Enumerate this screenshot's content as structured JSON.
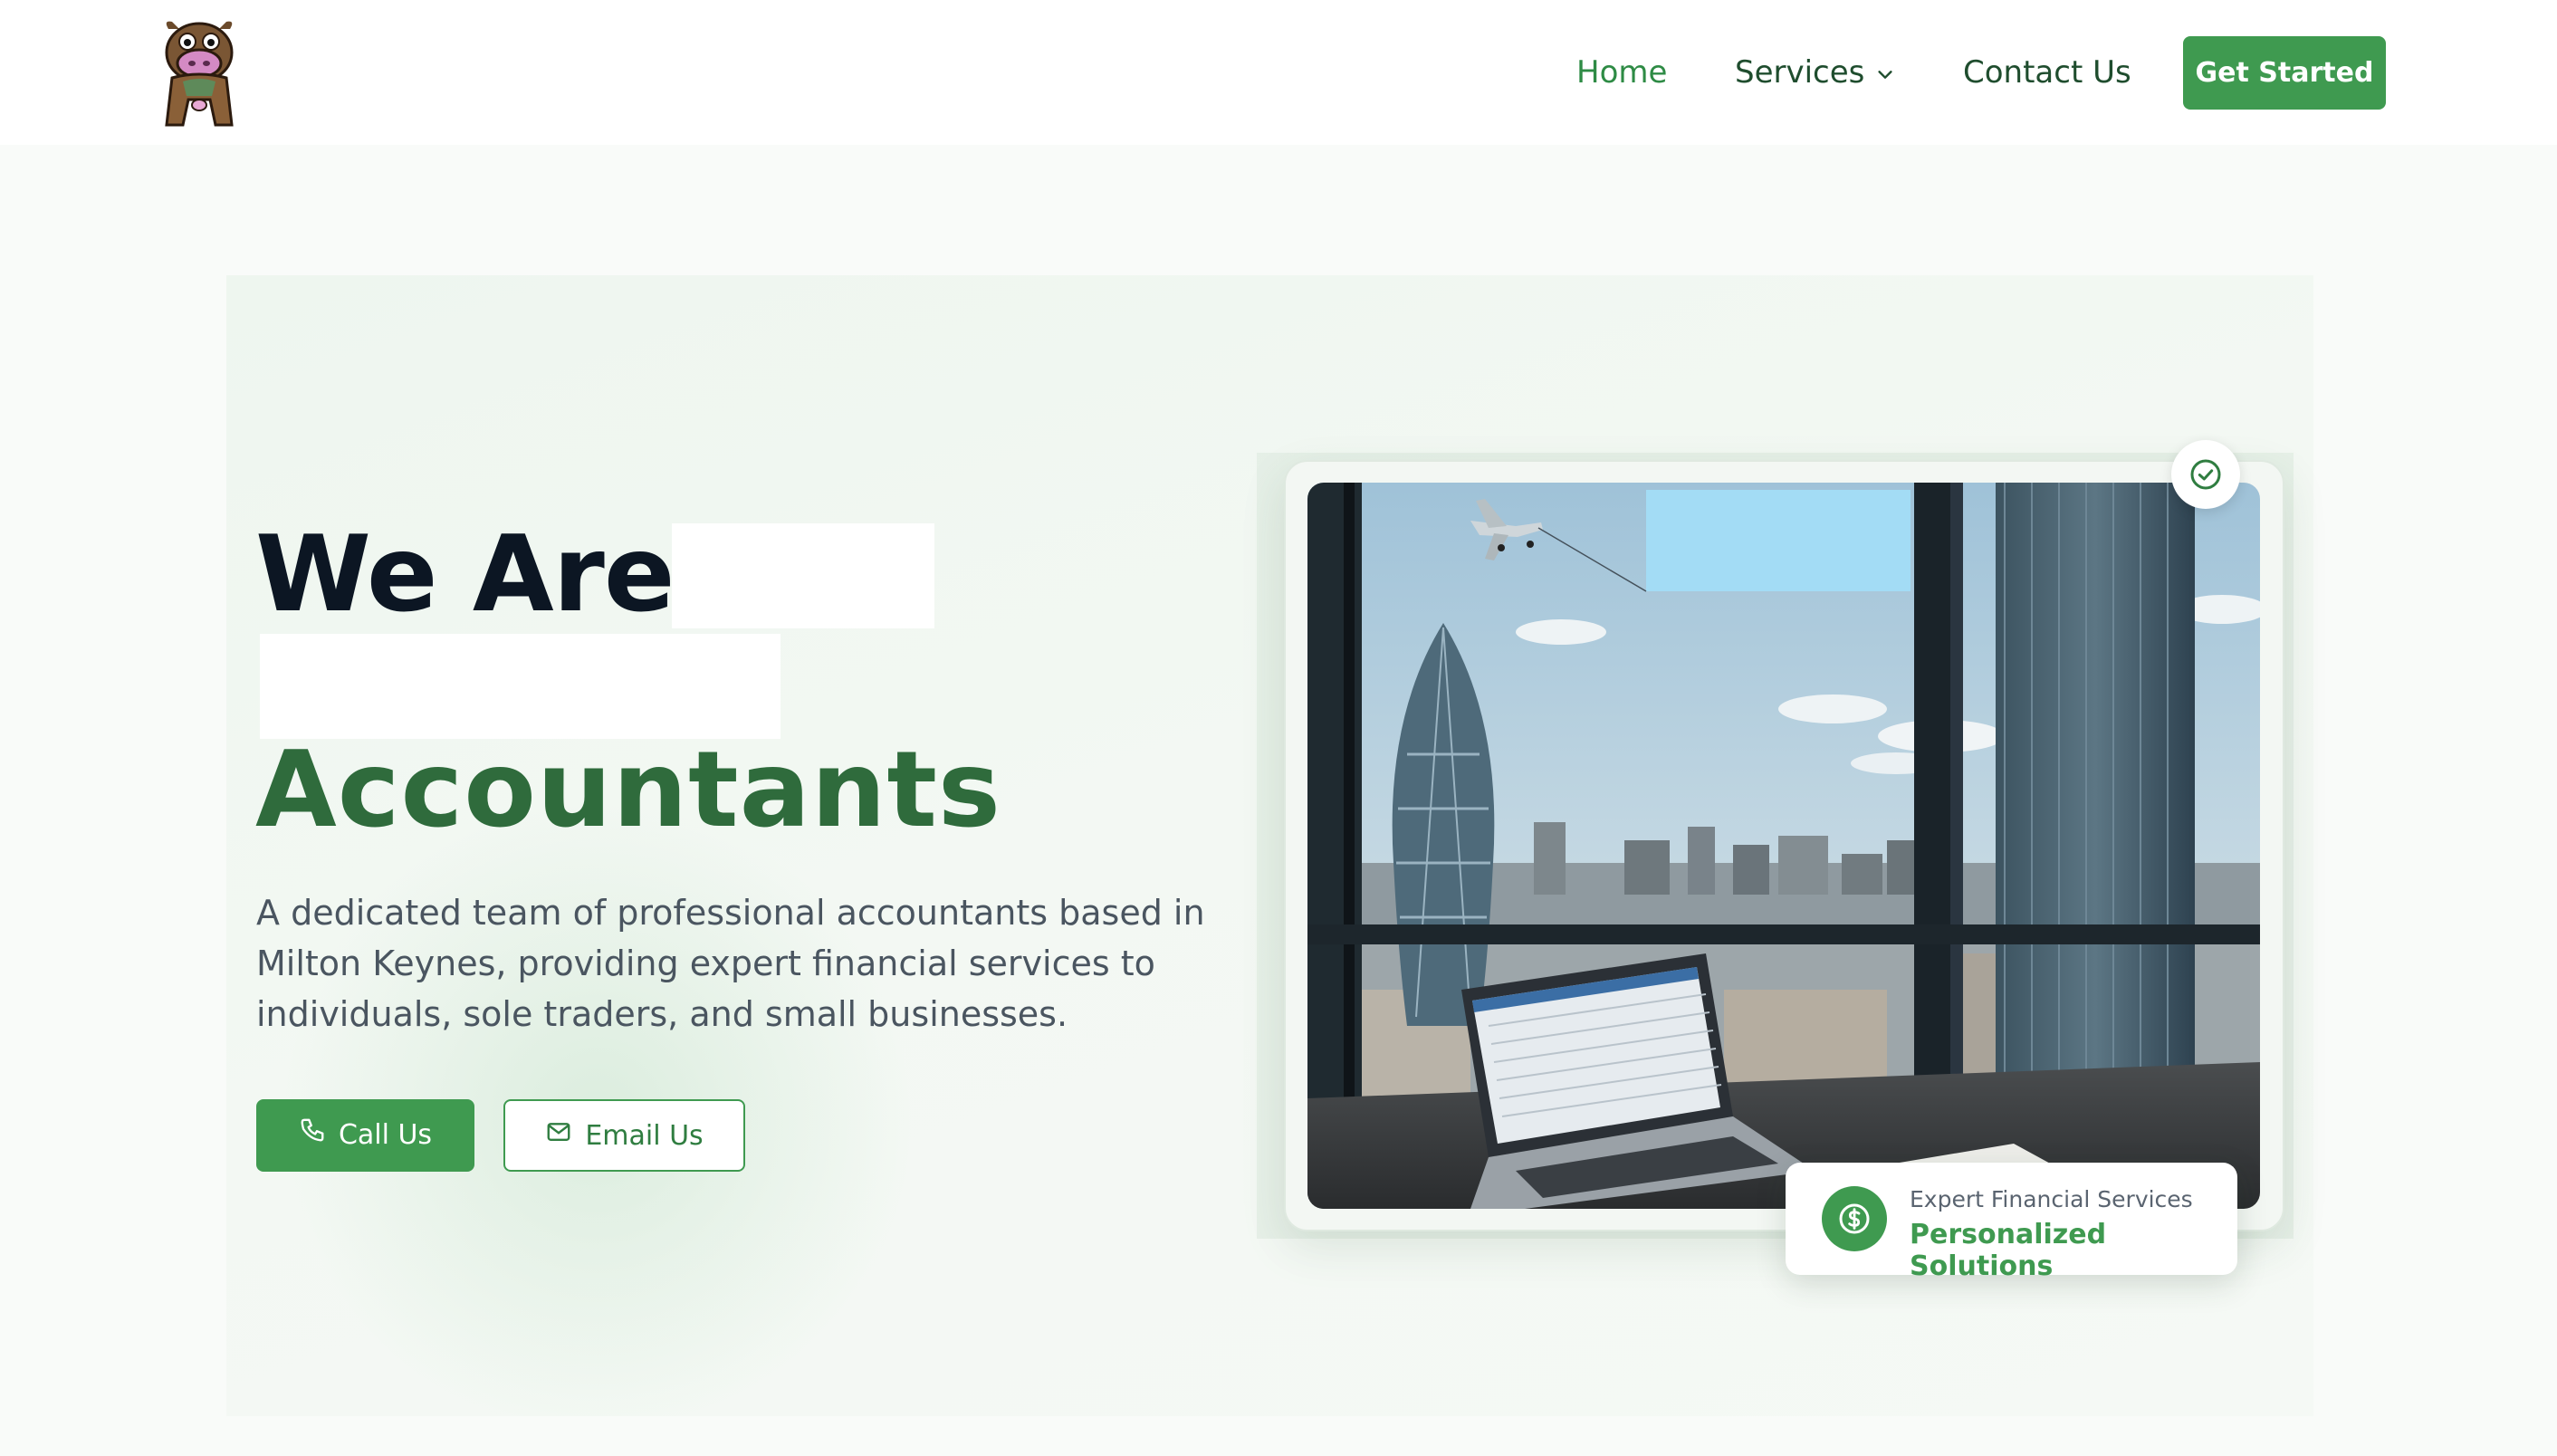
{
  "header": {
    "nav": {
      "home": "Home",
      "services": "Services",
      "contact": "Contact Us"
    },
    "cta": "Get Started"
  },
  "hero": {
    "headline_line1": "We Are",
    "headline_line3": "Accountants",
    "description": "A dedicated team of professional accountants based in Milton Keynes, providing expert financial services to individuals, sole traders, and small businesses.",
    "call_button": "Call Us",
    "email_button": "Email Us",
    "info_card": {
      "subtitle": "Expert Financial Services",
      "title": "Personalized Solutions"
    }
  },
  "colors": {
    "brand_green": "#3f9a50",
    "dark_green": "#2f6b3c",
    "text_dark": "#0c1623",
    "hero_bg": "#eef6ef"
  },
  "icons": {
    "logo": "cow-mascot-logo",
    "services_dropdown": "chevron-down-icon",
    "call": "phone-icon",
    "email": "mail-icon",
    "badge": "check-circle-icon",
    "info": "dollar-circle-icon"
  }
}
